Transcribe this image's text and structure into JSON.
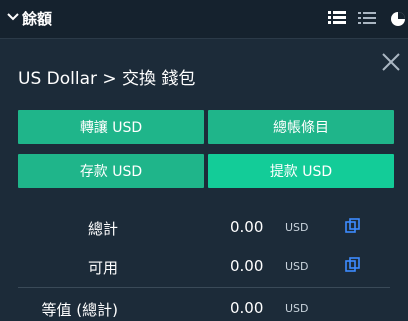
{
  "header": {
    "title": "餘額"
  },
  "panel": {
    "breadcrumb": "US Dollar > 交換 錢包"
  },
  "buttons": {
    "transfer": "轉讓 USD",
    "ledger": "總帳條目",
    "deposit": "存款 USD",
    "withdraw": "提款 USD"
  },
  "balances": [
    {
      "label": "總計",
      "value": "0.00",
      "unit": "USD"
    },
    {
      "label": "可用",
      "value": "0.00",
      "unit": "USD"
    },
    {
      "label": "等值 (總計)",
      "value": "0.00",
      "unit": "USD"
    }
  ],
  "colors": {
    "background": "#1c2b39",
    "header": "#15222e",
    "button_green": "#1fb58a",
    "button_green_light": "#13cc98",
    "copy_icon": "#3d8bff"
  }
}
